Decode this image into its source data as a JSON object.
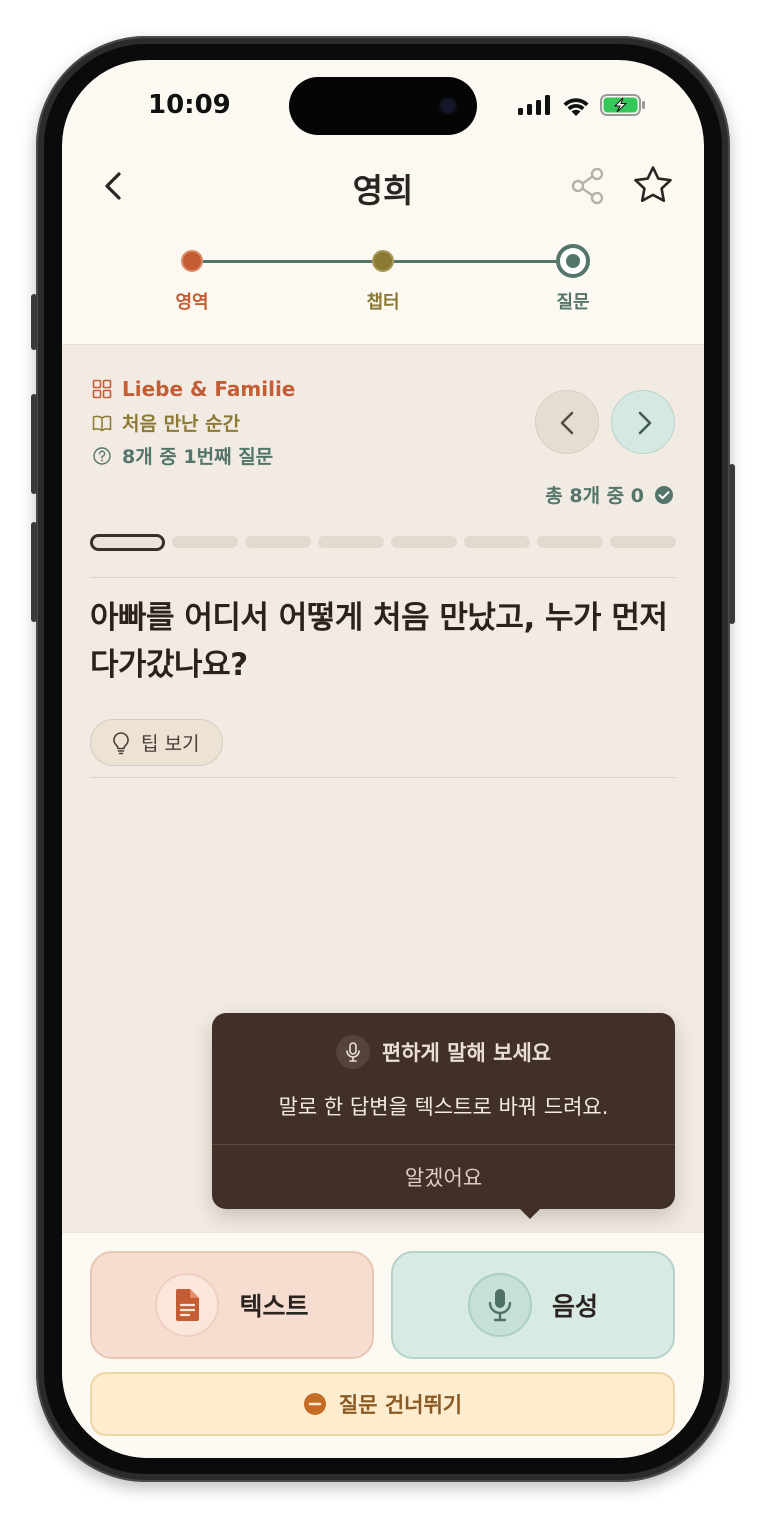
{
  "status_bar": {
    "time": "10:09"
  },
  "header": {
    "title": "영희"
  },
  "stepper": {
    "steps": [
      {
        "label": "영역",
        "color": "#c55d34"
      },
      {
        "label": "챕터",
        "color": "#8c7a33"
      },
      {
        "label": "질문",
        "color": "#54766a"
      }
    ]
  },
  "question_meta": {
    "area": "Liebe & Familie",
    "chapter": "처음 만난 순간",
    "position": "8개 중 1번째 질문"
  },
  "progress": {
    "count_text": "총 8개 중 0",
    "total": 8,
    "current": 1
  },
  "question": {
    "text": "아빠를 어디서 어떻게 처음 만났고, 누가 먼저 다가갔나요?"
  },
  "tip": {
    "label": "팁 보기"
  },
  "tooltip": {
    "title": "편하게 말해 보세요",
    "body": "말로 한 답변을 텍스트로 바꿔 드려요.",
    "ok_label": "알겠어요"
  },
  "actions": {
    "text_label": "텍스트",
    "voice_label": "음성",
    "skip_label": "질문 건너뛰기"
  },
  "colors": {
    "accent_orange": "#c55d34",
    "accent_olive": "#8c7a33",
    "accent_teal": "#54766a",
    "tooltip_bg": "#403027"
  }
}
